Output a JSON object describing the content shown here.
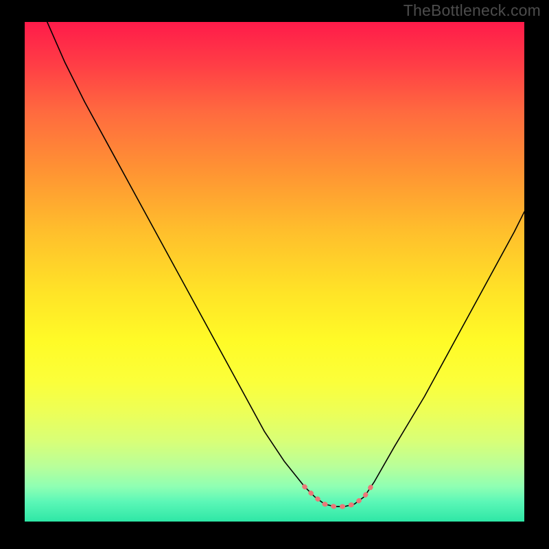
{
  "watermark": "TheBottleneck.com",
  "chart_data": {
    "type": "line",
    "title": "",
    "xlabel": "",
    "ylabel": "",
    "xlim": [
      0,
      100
    ],
    "ylim": [
      0,
      100
    ],
    "grid": false,
    "series": [
      {
        "name": "curve",
        "color": "#000000",
        "x": [
          4.5,
          8,
          12,
          18,
          24,
          30,
          36,
          42,
          48,
          52,
          56,
          58,
          60,
          62,
          64,
          66,
          68,
          70,
          74,
          80,
          86,
          92,
          98,
          100
        ],
        "y": [
          100,
          92,
          84,
          73,
          62,
          51,
          40,
          29,
          18,
          12,
          7,
          5,
          3.5,
          3,
          3,
          3.5,
          5,
          8,
          15,
          25,
          36,
          47,
          58,
          62
        ]
      },
      {
        "name": "highlight",
        "color": "#e97878",
        "x": [
          56,
          58,
          60,
          62,
          64,
          66,
          68,
          70
        ],
        "y": [
          7,
          5,
          3.5,
          3,
          3,
          3.5,
          5,
          8
        ]
      }
    ],
    "gradient_stops": [
      {
        "pos": 0,
        "color": "#ff1b4a"
      },
      {
        "pos": 18,
        "color": "#ff6a3f"
      },
      {
        "pos": 42,
        "color": "#ffbf2c"
      },
      {
        "pos": 64,
        "color": "#fffb27"
      },
      {
        "pos": 84,
        "color": "#d8ff78"
      },
      {
        "pos": 100,
        "color": "#2ee7a6"
      }
    ]
  }
}
